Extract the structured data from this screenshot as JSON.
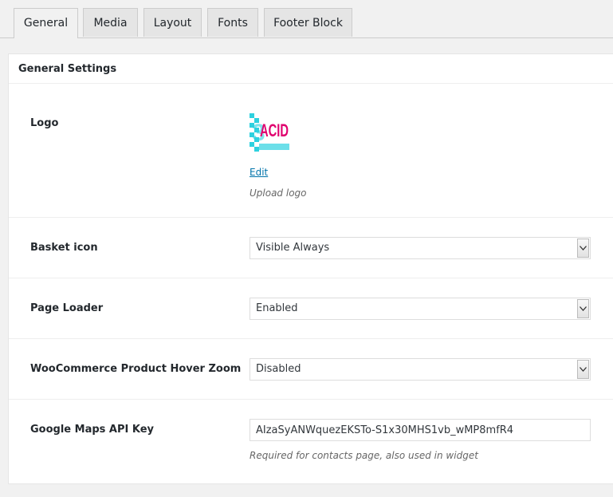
{
  "tabs": [
    {
      "label": "General",
      "active": true
    },
    {
      "label": "Media",
      "active": false
    },
    {
      "label": "Layout",
      "active": false
    },
    {
      "label": "Fonts",
      "active": false
    },
    {
      "label": "Footer Block",
      "active": false
    }
  ],
  "panel": {
    "title": "General Settings"
  },
  "logo": {
    "label": "Logo",
    "image_text": "ACID",
    "edit_label": "Edit",
    "help": "Upload logo"
  },
  "basket_icon": {
    "label": "Basket icon",
    "value": "Visible Always"
  },
  "page_loader": {
    "label": "Page Loader",
    "value": "Enabled"
  },
  "hover_zoom": {
    "label": "WooCommerce Product Hover Zoom",
    "value": "Disabled"
  },
  "maps_key": {
    "label": "Google Maps API Key",
    "value": "AIzaSyANWquezEKSTo-S1x30MHS1vb_wMP8mfR4",
    "help": "Required for contacts page, also used in widget"
  },
  "colors": {
    "link": "#0073aa",
    "logo_pink": "#e0006e",
    "logo_cyan": "#2ed1df"
  }
}
